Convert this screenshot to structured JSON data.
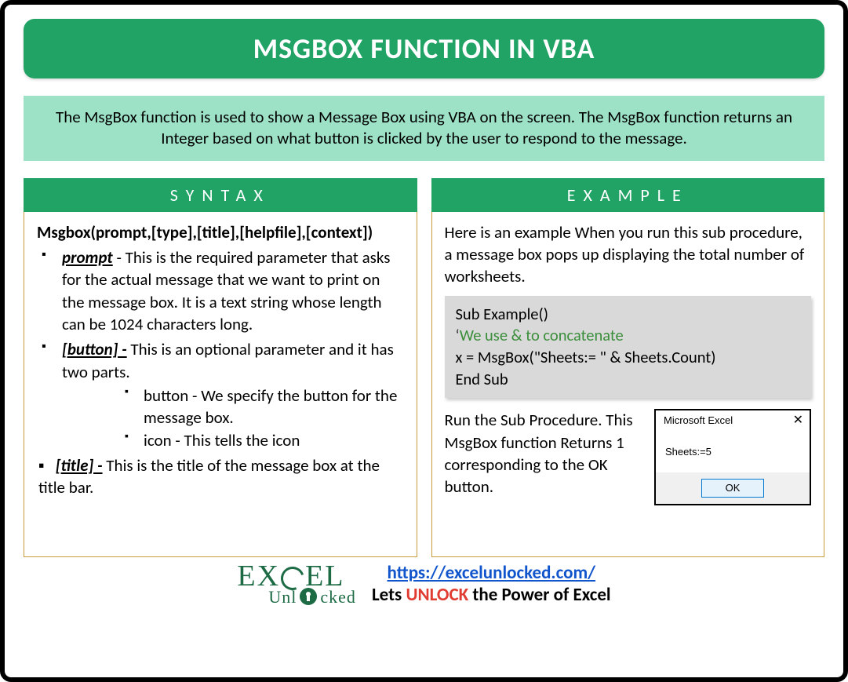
{
  "title": "MSGBOX FUNCTION IN VBA",
  "intro": "The MsgBox function is used to show a Message Box using VBA on the screen. The MsgBox function returns an Integer based on what button is clicked by the user to respond to the message.",
  "syntax": {
    "header": "SYNTAX",
    "signature": "Msgbox(prompt,[type],[title],[helpfile],[context])",
    "params": {
      "prompt": {
        "name": "prompt",
        "desc": " - This is the required parameter that asks for the actual message that we want to print on the message box. It is a text string whose length can be 1024 characters long."
      },
      "button": {
        "name": "[button] -",
        "desc": " This is an optional parameter and it has two parts.",
        "sub": {
          "a": "button - We specify the button for the message box.",
          "b": "icon - This tells the icon"
        }
      },
      "title": {
        "name": "[title] -",
        "desc": " This is the title of the message box at the title bar."
      }
    }
  },
  "example": {
    "header": "EXAMPLE",
    "intro": "Here is an example When you run this sub procedure, a message box pops up displaying the total number of worksheets.",
    "code": {
      "l1": "Sub Example()",
      "tick": "‘",
      "comment": "We use & to concatenate",
      "l3": "x = MsgBox(\"Sheets:= \" & Sheets.Count)",
      "l4": "End Sub"
    },
    "run_text": "Run the Sub Procedure. This MsgBox function Returns 1 corresponding to the OK button.",
    "msgbox": {
      "title": "Microsoft Excel",
      "close": "✕",
      "body": "Sheets:=5",
      "ok": "OK"
    }
  },
  "footer": {
    "logo_top_left": "EX",
    "logo_top_right": "EL",
    "logo_bottom_left": "Unl",
    "logo_bottom_right": "cked",
    "url": "https://excelunlocked.com/",
    "tag_pre": "Lets ",
    "tag_hi": "UNLOCK",
    "tag_post": " the Power of Excel"
  }
}
